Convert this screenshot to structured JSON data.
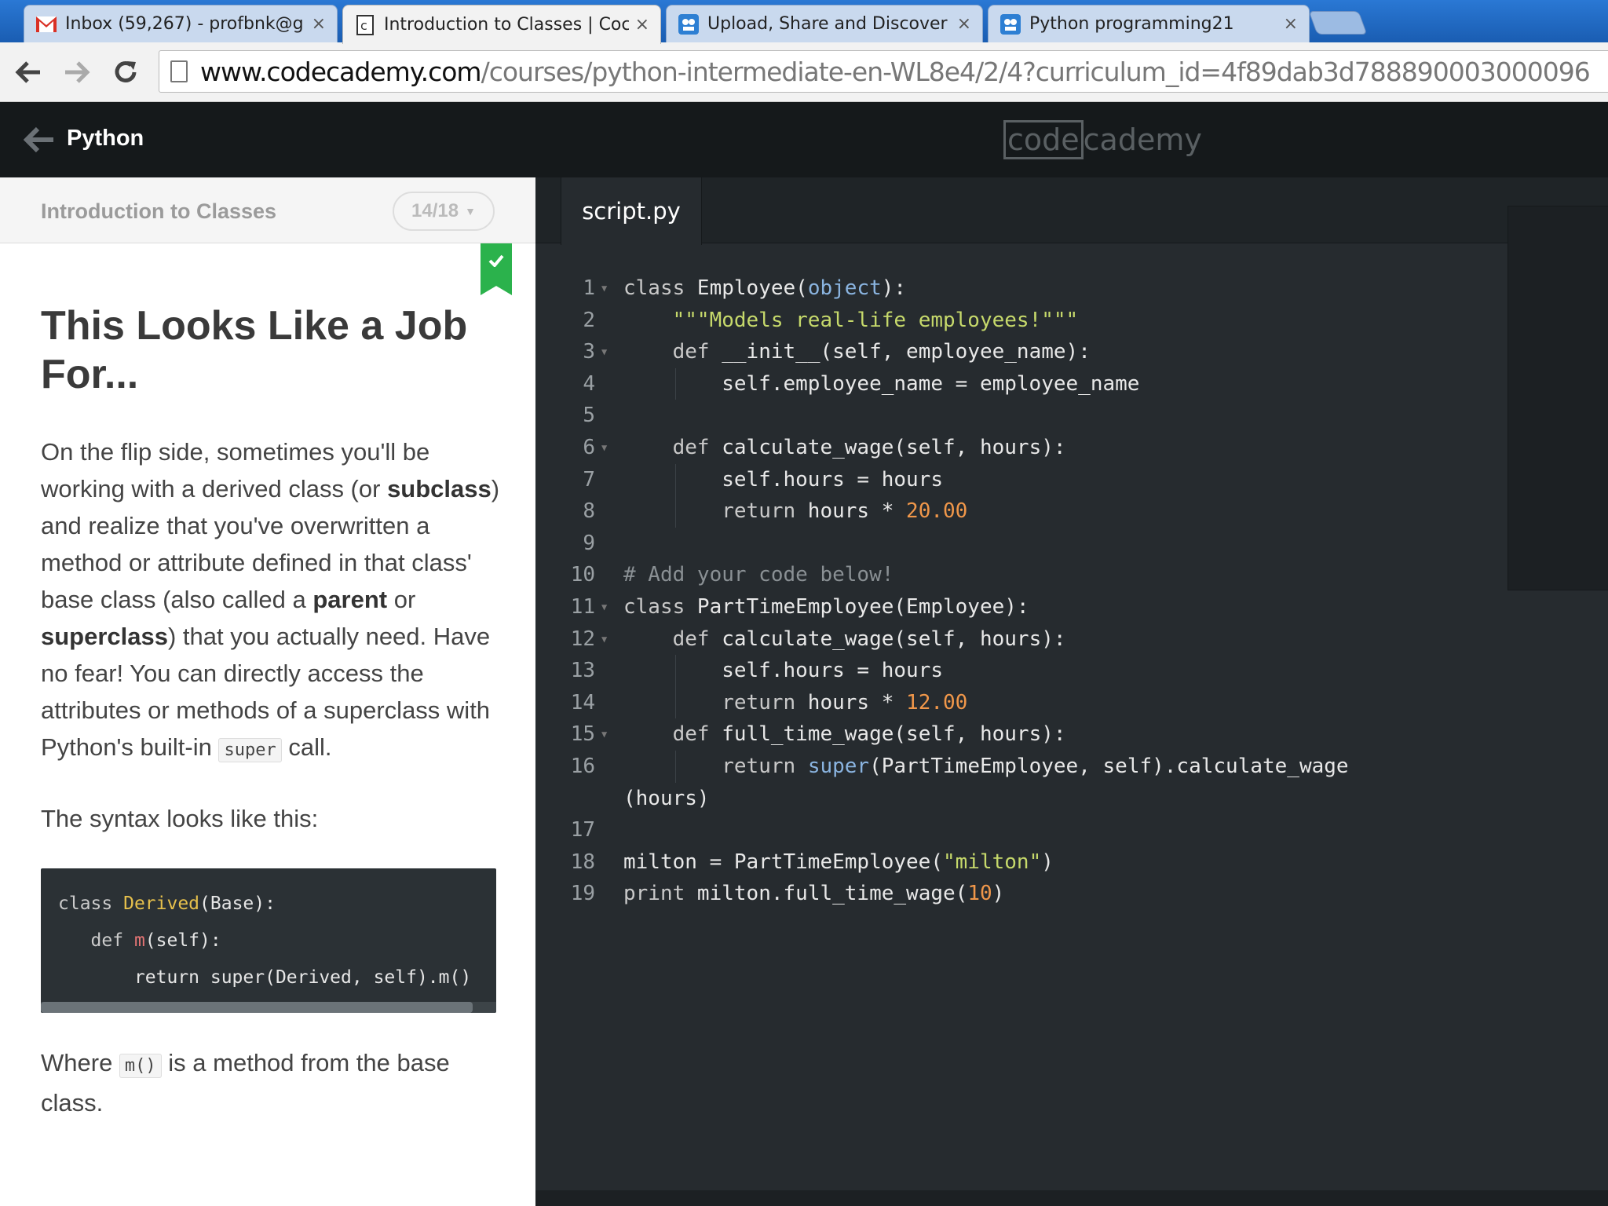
{
  "browser": {
    "tabs": [
      {
        "title": "Inbox (59,267) - profbnk@g",
        "icon": "gmail-icon",
        "active": false
      },
      {
        "title": "Introduction to Classes | Coc",
        "icon": "codecademy-icon",
        "active": true
      },
      {
        "title": "Upload, Share and Discover",
        "icon": "upload-site-icon",
        "active": false
      },
      {
        "title": "Python programming21",
        "icon": "upload-site-icon",
        "active": false
      }
    ],
    "close_glyph": "×",
    "url_host": "www.codecademy.com",
    "url_path": "/courses/python-intermediate-en-WL8e4/2/4?curriculum_id=4f89dab3d788890003000096"
  },
  "header": {
    "back_arrow": "arrow-left-icon",
    "course_name": "Python",
    "logo_boxed": "code",
    "logo_rest": "cademy"
  },
  "lesson": {
    "unit_title": "Introduction to Classes",
    "progress": "14/18",
    "progress_value": {
      "current": 14,
      "total": 18
    },
    "completed": true,
    "heading": "This Looks Like a Job For...",
    "para1": {
      "t1": "On the flip side, sometimes you'll be working with a derived class (or ",
      "b1": "subclass",
      "t2": ") and realize that you've overwritten a method or attribute defined in that class' base class (also called a ",
      "b2": "parent",
      "t3": " or ",
      "b3": "superclass",
      "t4": ") that you actually need. Have no fear! You can directly access the attributes or methods of a superclass with Python's built-in ",
      "code": "super",
      "t5": " call."
    },
    "para2": "The syntax looks like this:",
    "example": {
      "l1_kw": "class ",
      "l1_cls": "Derived",
      "l1_rest": "(Base):",
      "l2_kw": "def ",
      "l2_fn": "m",
      "l2_rest": "(self):",
      "l3": "return super(Derived, self).m()"
    },
    "para3": {
      "t1": "Where ",
      "code": "m()",
      "t2": " is a method from the base class."
    }
  },
  "editor": {
    "filename": "script.py",
    "colors": {
      "keyword": "#c9c9c9",
      "builtin": "#8ab4e0",
      "string": "#c6d96b",
      "number": "#f0974a",
      "comment": "#8a9094"
    }
  }
}
